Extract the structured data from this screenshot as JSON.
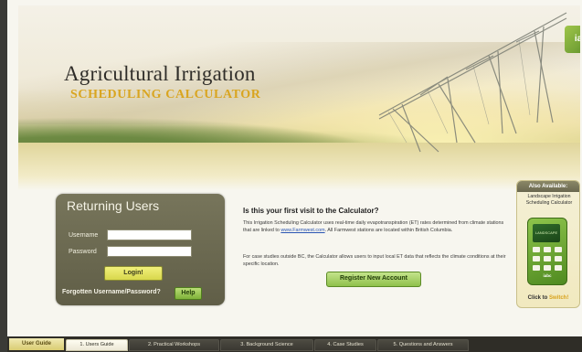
{
  "header": {
    "title": "Agricultural Irrigation",
    "subtitle": "SCHEDULING CALCULATOR",
    "logo_text": "ia"
  },
  "login": {
    "title": "Returning Users",
    "username_label": "Username",
    "password_label": "Password",
    "username_value": "",
    "password_value": "",
    "login_button": "Login!",
    "forgot_text": "Forgotten Username/Password?",
    "help_button": "Help"
  },
  "info": {
    "heading": "Is this your first visit to the Calculator?",
    "para1_before_link": "This Irrigation Scheduling Calculator uses real-time daily evapotranspiration (ET) rates determined from climate stations that are linked to ",
    "link_text": "www.Farmwest.com",
    "para1_after_link": ". All Farmwest stations are located within British Columbia.",
    "para2": "For case studies outside BC, the Calculator allows users to input local ET data that reflects the climate conditions at their specific location.",
    "register_button": "Register New Account"
  },
  "promo": {
    "header": "Also Available:",
    "text": "Landscape Irrigation Scheduling Calculator",
    "phone_screen": "LANDSCAPE",
    "phone_brand": "iabc",
    "click_prefix": "Click to ",
    "click_accent": "Switch!"
  },
  "tabs": {
    "lead": "User Guide",
    "items": [
      {
        "label": "1. Users Guide"
      },
      {
        "label": "2. Practical Workshops"
      },
      {
        "label": "3. Background Science"
      },
      {
        "label": "4. Case Studies"
      },
      {
        "label": "5. Questions and Answers"
      }
    ]
  },
  "colors": {
    "accent": "#d9a520",
    "login_panel": "#6a6850",
    "button_green": "#8fc04b",
    "button_yellow": "#e6e45f"
  }
}
